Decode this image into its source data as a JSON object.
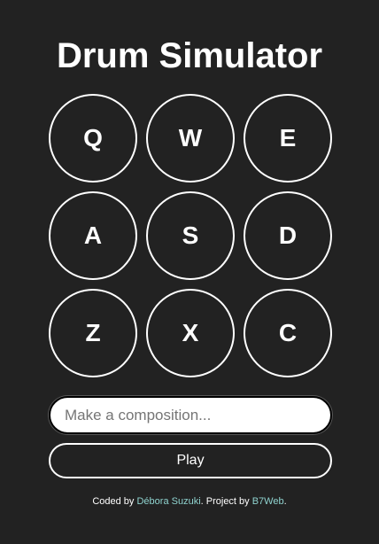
{
  "header": {
    "title": "Drum Simulator"
  },
  "keys": [
    {
      "label": "Q"
    },
    {
      "label": "W"
    },
    {
      "label": "E"
    },
    {
      "label": "A"
    },
    {
      "label": "S"
    },
    {
      "label": "D"
    },
    {
      "label": "Z"
    },
    {
      "label": "X"
    },
    {
      "label": "C"
    }
  ],
  "composition": {
    "value": "",
    "placeholder": "Make a composition..."
  },
  "play_button": {
    "label": "Play"
  },
  "footer": {
    "coded_by_prefix": "Coded by ",
    "author": "Débora Suzuki",
    "project_prefix": ". Project by ",
    "project": "B7Web",
    "suffix": "."
  },
  "colors": {
    "background": "#222222",
    "text": "#ffffff",
    "link": "#8fd3cf"
  }
}
